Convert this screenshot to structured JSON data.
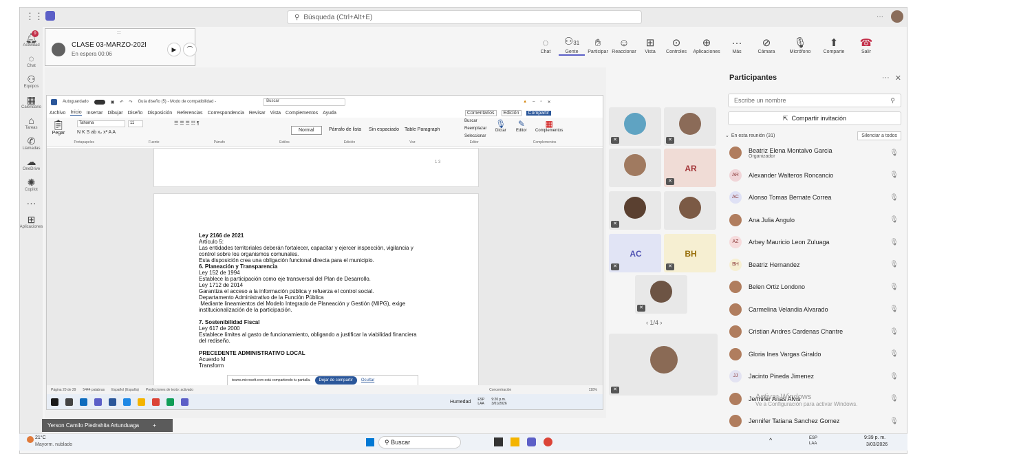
{
  "search": {
    "placeholder": "Búsqueda (Ctrl+Alt+E)"
  },
  "titlebar": {
    "more": "···"
  },
  "rail": [
    {
      "label": "Actividad",
      "icon": "bell-icon",
      "badge": "9"
    },
    {
      "label": "Chat",
      "icon": "chat-icon"
    },
    {
      "label": "Equipos",
      "icon": "teams-icon"
    },
    {
      "label": "Calendario",
      "icon": "calendar-icon"
    },
    {
      "label": "Tareas",
      "icon": "tasks-icon"
    },
    {
      "label": "Llamadas",
      "icon": "phone-icon"
    },
    {
      "label": "OneDrive",
      "icon": "onedrive-icon"
    },
    {
      "label": "Copilot",
      "icon": "copilot-icon"
    },
    {
      "label": "···",
      "icon": "more-icon"
    },
    {
      "label": "Aplicaciones",
      "icon": "apps-icon"
    }
  ],
  "pip": {
    "title": "CLASE 03-MARZO-202I",
    "status": "En espera  00:06",
    "dots": ":::"
  },
  "meeting_bar": {
    "chat": "Chat",
    "people_count": "31",
    "people": "Gente",
    "raise": "Participar",
    "react": "Reaccionar",
    "view": "Vista",
    "controls": "Controles",
    "apps": "Aplicaciones",
    "more": "Más",
    "camera": "Cámara",
    "mic": "Micrófono",
    "share": "Comparte",
    "leave": "Salir"
  },
  "word": {
    "autosave": "Autoguardado",
    "doc_title": "Guía diseño (5) - Modo de compatibilidad -",
    "search": "Buscar",
    "menu": [
      "Archivo",
      "Inicio",
      "Insertar",
      "Dibujar",
      "Diseño",
      "Disposición",
      "Referencias",
      "Correspondencia",
      "Revisar",
      "Vista",
      "Complementos",
      "Ayuda"
    ],
    "comments": "Comentarios",
    "edit": "Edición",
    "share": "Compartir",
    "font": "Tahoma",
    "size": "11",
    "paste": "Pegar",
    "styles": [
      "Normal",
      "Párrafo de lista",
      "Sin espaciado",
      "Table Paragraph"
    ],
    "buscar": "Buscar",
    "reemplazar": "Reemplazar",
    "seleccionar": "Seleccionar",
    "dictar": "Dictar",
    "editor": "Editor",
    "complementos": "Complementos",
    "group_labels": [
      "Portapapeles",
      "Fuente",
      "Párrafo",
      "Estilos",
      "Edición",
      "Voz",
      "Editor",
      "Complementos"
    ],
    "page_number": "1 3",
    "doc_lines": [
      "Ley 2166 de 2021",
      "Artículo 5:",
      "Las entidades territoriales deberán fortalecer, capacitar y ejercer inspección, vigilancia y",
      "control sobre los organismos comunales.",
      "Esta disposición crea una obligación funcional directa para el municipio.",
      "6. Planeación y Transparencia",
      "Ley 152 de 1994",
      "Establece la participación como eje transversal del Plan de Desarrollo.",
      "Ley 1712 de 2014",
      "Garantiza el acceso a la información pública y refuerza el control social.",
      "Departamento Administrativo de la Función Pública",
      " Mediante lineamientos del Modelo Integrado de Planeación y Gestión (MIPG), exige",
      "institucionalización de la participación.",
      "",
      "7. Sostenibilidad Fiscal",
      "Ley 617 de 2000",
      "Establece límites al gasto de funcionamiento, obligando a justificar la viabilidad financiera",
      "del rediseño.",
      "",
      "PRECEDENTE ADMINISTRATIVO LOCAL",
      "Acuerdo M",
      "Transform"
    ],
    "status_page": "Página 20 de 29",
    "status_words": "5444 palabras",
    "status_lang": "Español (España)",
    "status_pred": "Predicciones de texto: activado",
    "sharing_msg": "teams.microsoft.com está compartiendo tu pantalla.",
    "stop_share": "Dejar de compartir",
    "hide": "Ocultar",
    "focus": "Concentración",
    "zoom": "110%",
    "task_weather": "Humedad",
    "task_lang": "ESP\nLAA",
    "task_time": "9:20 p.m.\n3/01/2026"
  },
  "tiles": {
    "initials": [
      "AR",
      "AC",
      "BH"
    ],
    "pager": "1/4"
  },
  "panel": {
    "title": "Participantes",
    "search_placeholder": "Escribe un nombre",
    "invite": "Compartir invitación",
    "in_meeting": "En esta reunión (31)",
    "mute_all": "Silenciar a todos",
    "participants": [
      {
        "name": "Beatriz Elena Montalvo Garcia",
        "role": "Organizador",
        "initials": ""
      },
      {
        "name": "Alexander Walteros Roncancio",
        "initials": "AR"
      },
      {
        "name": "Alonso Tomas Bernate Correa",
        "initials": "AC"
      },
      {
        "name": "Ana Julia Angulo",
        "initials": ""
      },
      {
        "name": "Arbey Mauricio Leon Zuluaga",
        "initials": "AZ"
      },
      {
        "name": "Beatriz Hernandez",
        "initials": "BH"
      },
      {
        "name": "Belen Ortiz Londono",
        "initials": ""
      },
      {
        "name": "Carmelina Velandia Alvarado",
        "initials": ""
      },
      {
        "name": "Cristian Andres Cardenas Chantre",
        "initials": ""
      },
      {
        "name": "Gloria Ines Vargas Giraldo",
        "initials": ""
      },
      {
        "name": "Jacinto Pineda Jimenez",
        "initials": "JJ"
      },
      {
        "name": "Jennifer Arias Alvis",
        "initials": ""
      },
      {
        "name": "Jennifer Tatiana Sanchez Gomez",
        "initials": ""
      }
    ],
    "watermark_1": "Activar Windows",
    "watermark_2": "Ve a Configuración para activar Windows."
  },
  "shared_bar": {
    "name": "Yerson Camilo Piedrahita Artunduaga",
    "plus": "+"
  },
  "taskbar": {
    "temp": "21°C",
    "weather": "Mayorm. nublado",
    "search": "Buscar",
    "lang": "ESP\nLAA",
    "time": "9:39 p. m.",
    "date": "3/03/2026"
  }
}
